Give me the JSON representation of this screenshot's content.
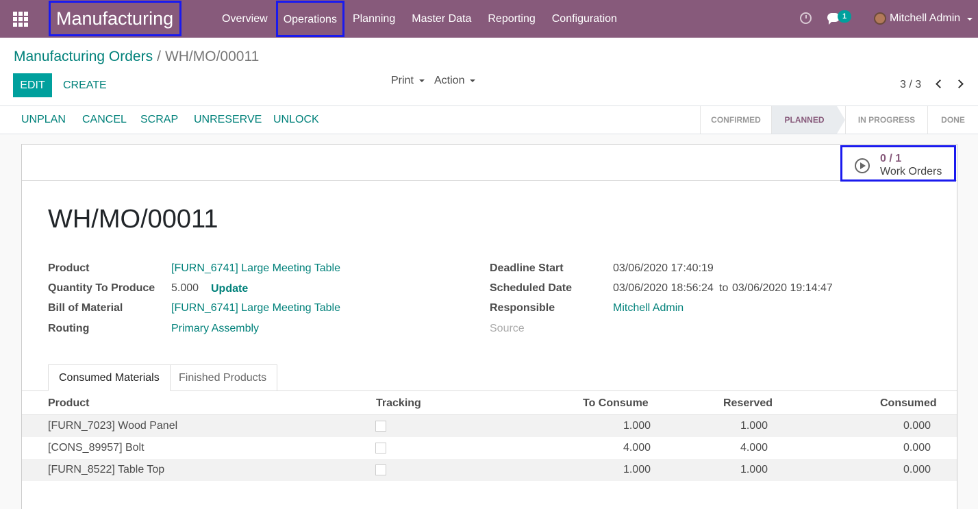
{
  "navbar": {
    "brand": "Manufacturing",
    "menu": [
      "Overview",
      "Operations",
      "Planning",
      "Master Data",
      "Reporting",
      "Configuration"
    ],
    "messages_count": "1",
    "user_name": "Mitchell Admin"
  },
  "control": {
    "breadcrumb_parent": "Manufacturing Orders",
    "breadcrumb_current": "WH/MO/00011",
    "edit_label": "EDIT",
    "create_label": "CREATE",
    "print_label": "Print",
    "action_label": "Action",
    "pager": "3 / 3"
  },
  "status_buttons": [
    "UNPLAN",
    "CANCEL",
    "SCRAP",
    "UNRESERVE",
    "UNLOCK"
  ],
  "stages": [
    "CONFIRMED",
    "PLANNED",
    "IN PROGRESS",
    "DONE"
  ],
  "active_stage": "PLANNED",
  "work_orders": {
    "count": "0 / 1",
    "label": "Work Orders"
  },
  "record": {
    "title": "WH/MO/00011",
    "left_fields": [
      {
        "label": "Product",
        "value": "[FURN_6741] Large Meeting Table"
      },
      {
        "label": "Quantity To Produce",
        "value": "5.000",
        "action": "Update"
      },
      {
        "label": "Bill of Material",
        "value": "[FURN_6741] Large Meeting Table"
      },
      {
        "label": "Routing",
        "value": "Primary Assembly"
      }
    ],
    "right_fields": [
      {
        "label": "Deadline Start",
        "value": "03/06/2020 17:40:19"
      },
      {
        "label": "Scheduled Date",
        "value_from": "03/06/2020 18:56:24",
        "sep": "to",
        "value_to": "03/06/2020 19:14:47"
      },
      {
        "label": "Responsible",
        "value": "Mitchell Admin"
      },
      {
        "label": "Source",
        "value": ""
      }
    ]
  },
  "tabs": [
    "Consumed Materials",
    "Finished Products"
  ],
  "table": {
    "headers": [
      "Product",
      "Tracking",
      "To Consume",
      "Reserved",
      "Consumed"
    ],
    "rows": [
      {
        "product": "[FURN_7023] Wood Panel",
        "to_consume": "1.000",
        "reserved": "1.000",
        "consumed": "0.000"
      },
      {
        "product": "[CONS_89957] Bolt",
        "to_consume": "4.000",
        "reserved": "4.000",
        "consumed": "0.000"
      },
      {
        "product": "[FURN_8522] Table Top",
        "to_consume": "1.000",
        "reserved": "1.000",
        "consumed": "0.000"
      }
    ]
  },
  "colors": {
    "brand": "#875a7b",
    "accent": "#00a09d",
    "link": "#00817a"
  }
}
